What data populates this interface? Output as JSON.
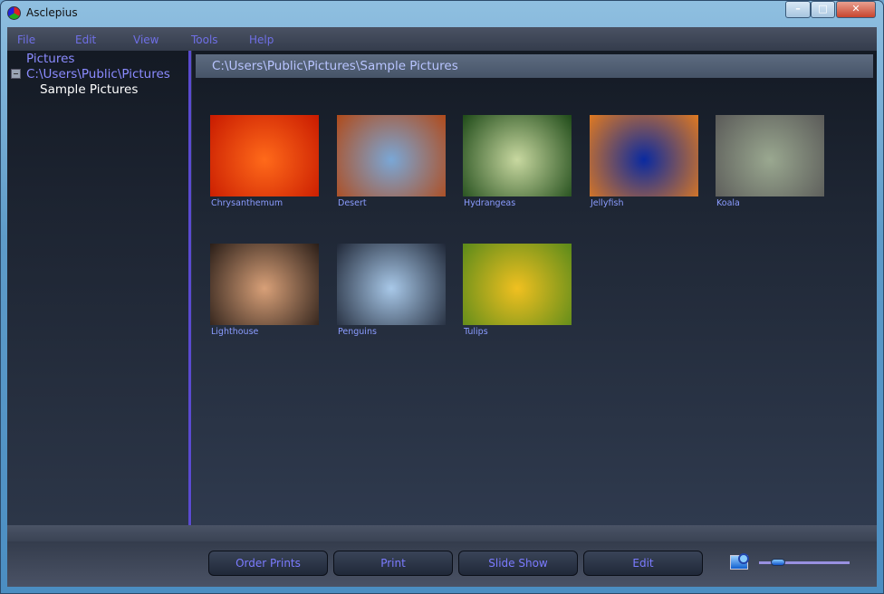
{
  "window": {
    "title": "Asclepius"
  },
  "menu": [
    "File",
    "Edit",
    "View",
    "Tools",
    "Help"
  ],
  "tree": {
    "root": "Pictures",
    "folder": "C:\\Users\\Public\\Pictures",
    "child": "Sample Pictures"
  },
  "path": "C:\\Users\\Public\\Pictures\\Sample Pictures",
  "thumbnails": [
    {
      "name": "Chrysanthemum",
      "colors": [
        "#ff6a1a",
        "#c81a00"
      ]
    },
    {
      "name": "Desert",
      "colors": [
        "#7aa7d6",
        "#b04a1a"
      ]
    },
    {
      "name": "Hydrangeas",
      "colors": [
        "#c8d8a0",
        "#1e4a18"
      ]
    },
    {
      "name": "Jellyfish",
      "colors": [
        "#0a2aa0",
        "#e07a20"
      ]
    },
    {
      "name": "Koala",
      "colors": [
        "#9aa890",
        "#5a5a58"
      ]
    },
    {
      "name": "Lighthouse",
      "colors": [
        "#d8a078",
        "#2a1e18"
      ]
    },
    {
      "name": "Penguins",
      "colors": [
        "#a8c8e8",
        "#202838"
      ]
    },
    {
      "name": "Tulips",
      "colors": [
        "#f0c020",
        "#5a8a1a"
      ]
    }
  ],
  "buttons": [
    "Order Prints",
    "Print",
    "Slide Show",
    "Edit"
  ],
  "zoom": {
    "icon": "zoom-picture-icon",
    "level": 0.15
  }
}
